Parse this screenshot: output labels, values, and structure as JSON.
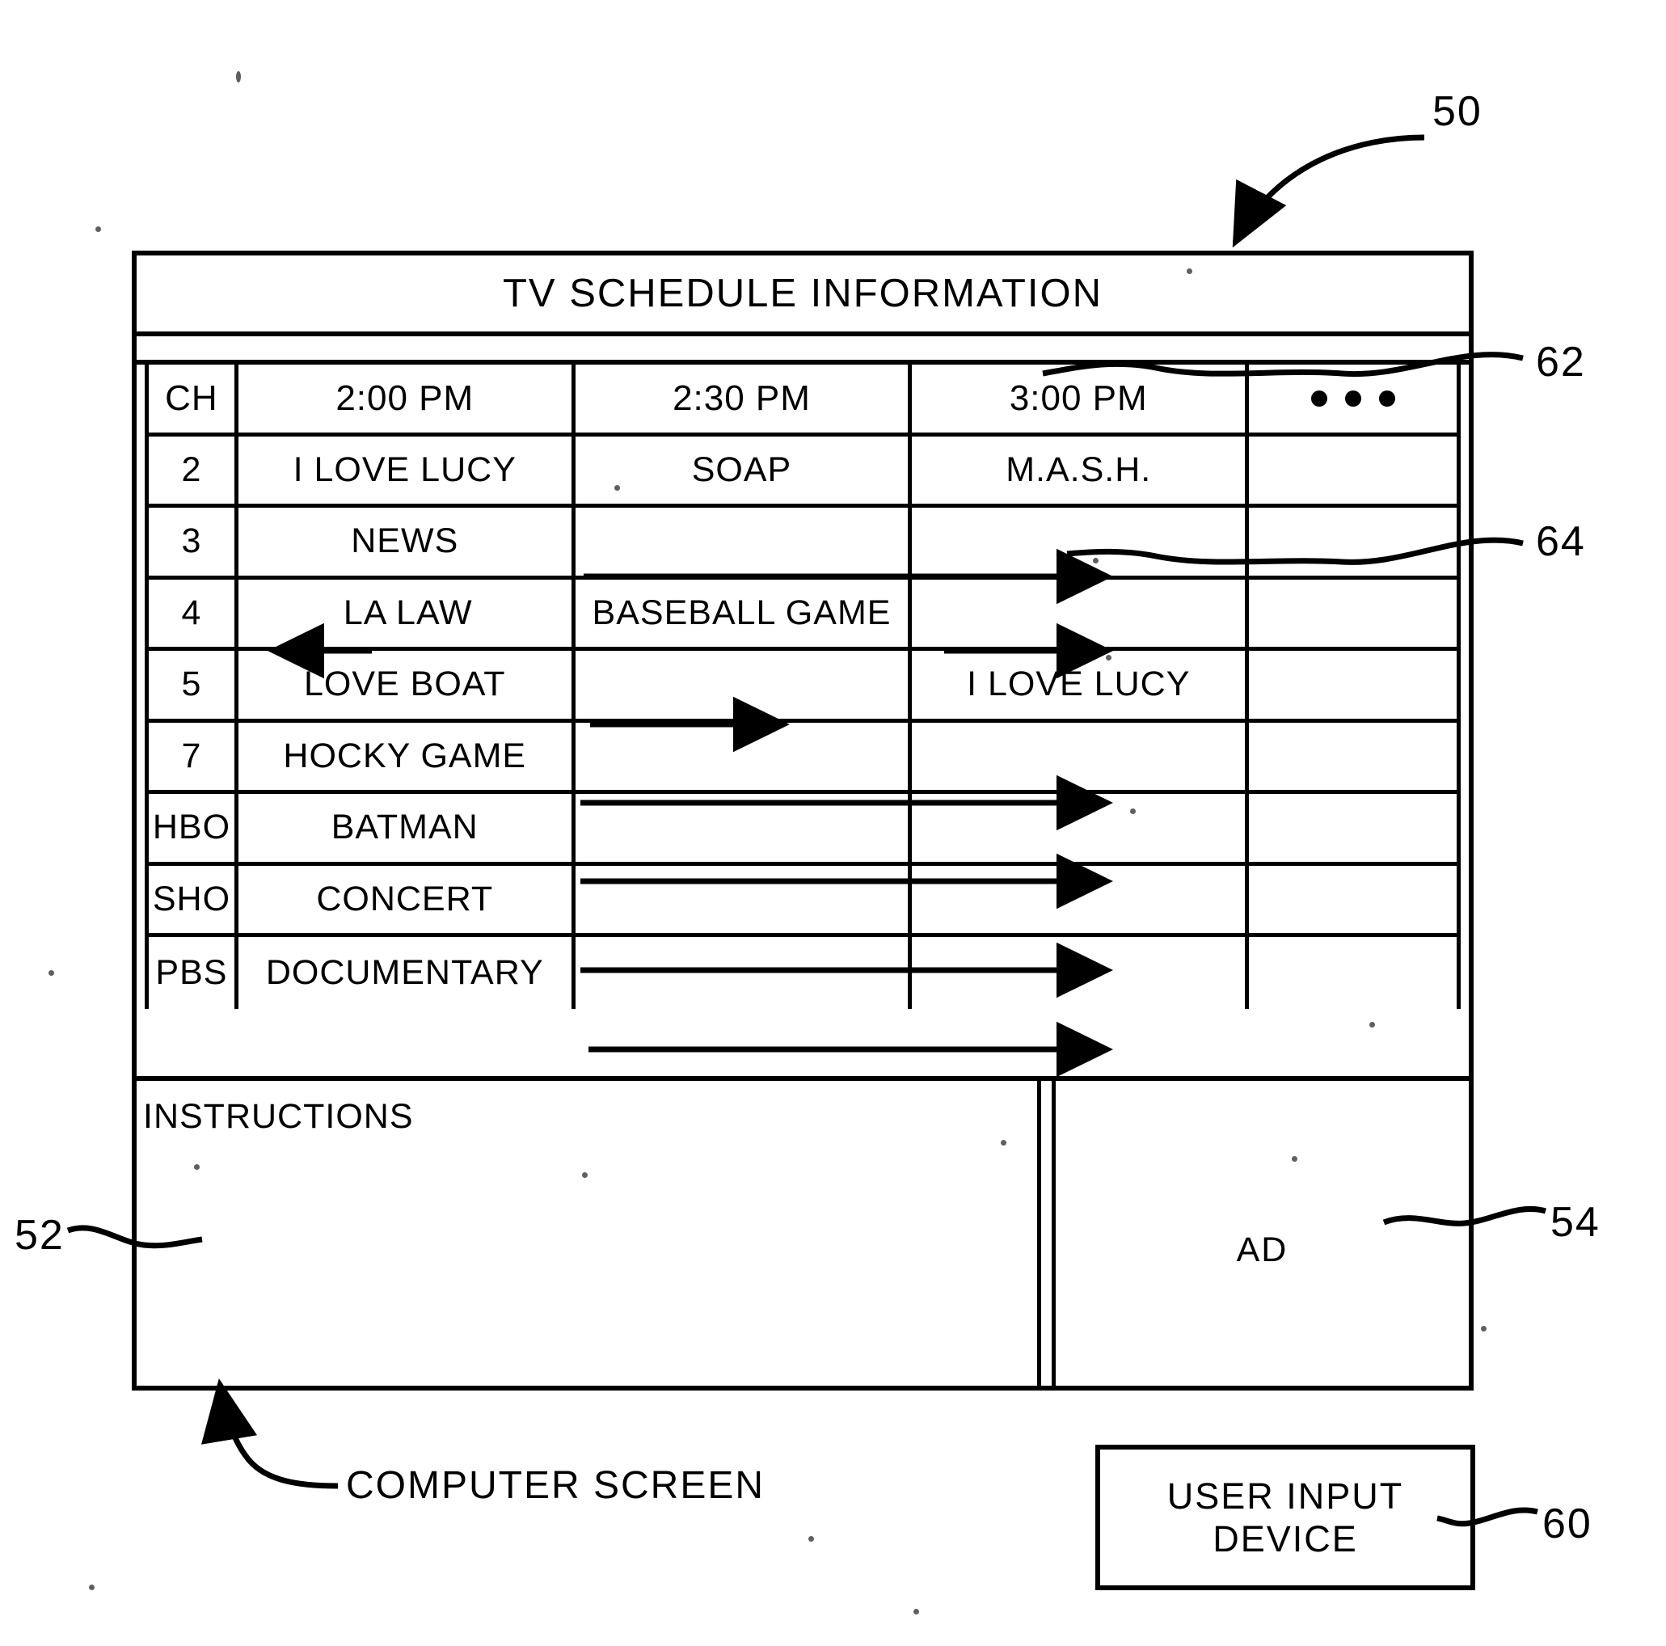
{
  "figure": {
    "title": "TV SCHEDULE INFORMATION",
    "caption_computer_screen": "COMPUTER SCREEN",
    "reference_numerals": {
      "screen": "50",
      "instructions_panel": "52",
      "ad_panel": "54",
      "user_input_device": "60",
      "program_mash": "62",
      "program_i_love_lucy": "64"
    }
  },
  "table": {
    "columns": [
      "CH",
      "2:00 PM",
      "2:30 PM",
      "3:00 PM",
      "more-dots"
    ],
    "headers": {
      "channel": "CH",
      "time1": "2:00 PM",
      "time2": "2:30 PM",
      "time3": "3:00 PM",
      "more": "• • •"
    },
    "rows": [
      {
        "channel": "2",
        "slot1": "I LOVE LUCY",
        "slot2": "SOAP",
        "slot3": "M.A.S.H.",
        "slot4": "",
        "continuation": "none"
      },
      {
        "channel": "3",
        "slot1": "NEWS",
        "slot2": "",
        "slot3": "",
        "slot4": "",
        "continuation": "right-to-3pm"
      },
      {
        "channel": "4",
        "slot1": "LA LAW",
        "slot2": "BASEBALL GAME",
        "slot3": "",
        "slot4": "",
        "continuation": "left-before-2pm-and-right-from-baseball"
      },
      {
        "channel": "5",
        "slot1": "LOVE BOAT",
        "slot2": "",
        "slot3": "I LOVE LUCY",
        "slot4": "",
        "continuation": "right-within-230"
      },
      {
        "channel": "7",
        "slot1": "HOCKY GAME",
        "slot2": "",
        "slot3": "",
        "slot4": "",
        "continuation": "right-to-3pm"
      },
      {
        "channel": "HBO",
        "slot1": "BATMAN",
        "slot2": "",
        "slot3": "",
        "slot4": "",
        "continuation": "right-to-3pm"
      },
      {
        "channel": "SHO",
        "slot1": "CONCERT",
        "slot2": "",
        "slot3": "",
        "slot4": "",
        "continuation": "right-to-3pm"
      },
      {
        "channel": "PBS",
        "slot1": "DOCUMENTARY",
        "slot2": "",
        "slot3": "",
        "slot4": "",
        "continuation": "right-to-3pm"
      }
    ]
  },
  "panels": {
    "instructions_label": "INSTRUCTIONS",
    "ad_label": "AD"
  },
  "user_input_device": {
    "line1": "USER INPUT",
    "line2": "DEVICE"
  },
  "colors": {
    "ink": "#000000",
    "paper": "#ffffff"
  }
}
